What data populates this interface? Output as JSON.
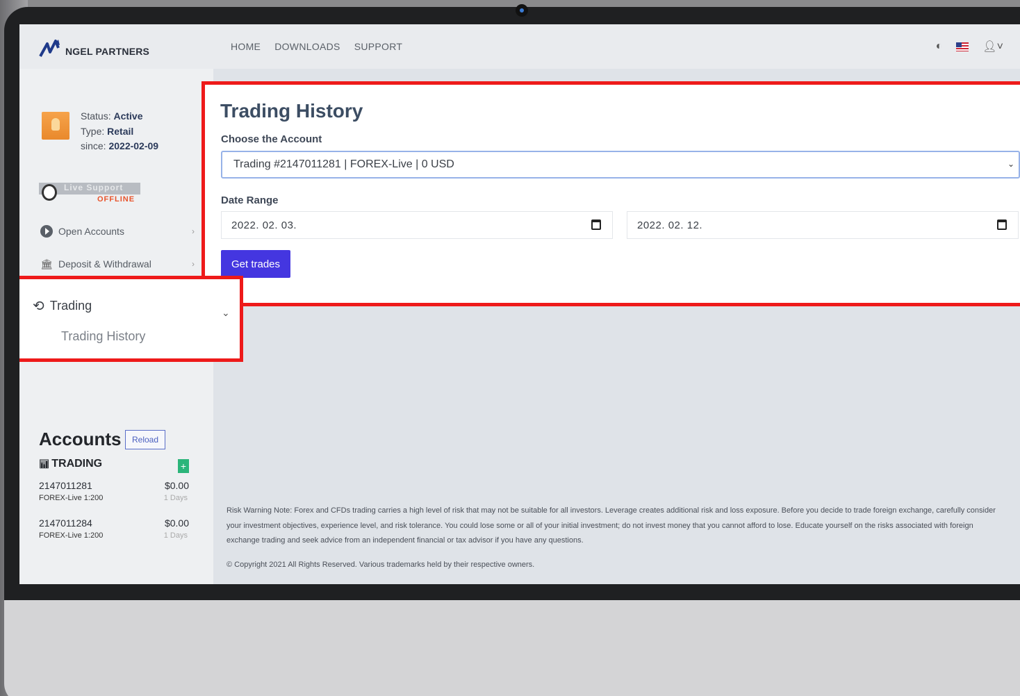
{
  "brand": {
    "name": "NGEL PARTNERS"
  },
  "nav": {
    "home": "HOME",
    "downloads": "DOWNLOADS",
    "support": "SUPPORT"
  },
  "profile": {
    "status_label": "Status:",
    "status_value": "Active",
    "type_label": "Type:",
    "type_value": "Retail",
    "since_label": "since:",
    "since_value": "2022-02-09"
  },
  "live_support": {
    "title": "Live Support",
    "state": "OFFLINE"
  },
  "sidebar": {
    "open_accounts": "Open Accounts",
    "deposit_withdrawal": "Deposit & Withdrawal",
    "trading": "Trading",
    "trading_history": "Trading History"
  },
  "accounts": {
    "title": "Accounts",
    "reload": "Reload",
    "group": "TRADING",
    "items": [
      {
        "number": "2147011281",
        "balance": "$0.00",
        "platform": "FOREX-Live 1:200",
        "days": "1 Days"
      },
      {
        "number": "2147011284",
        "balance": "$0.00",
        "platform": "FOREX-Live 1:200",
        "days": "1 Days"
      }
    ]
  },
  "main": {
    "title": "Trading History",
    "choose_account_label": "Choose the Account",
    "selected_account": "Trading #2147011281 | FOREX-Live | 0 USD",
    "date_range_label": "Date Range",
    "date_from": "2022. 02. 03.",
    "date_to": "2022. 02. 12.",
    "get_trades": "Get trades"
  },
  "footer": {
    "risk": "Risk Warning Note: Forex and CFDs trading carries a high level of risk that may not be suitable for all investors. Leverage creates additional risk and loss exposure. Before you decide to trade foreign exchange, carefully consider your investment objectives, experience level, and risk tolerance. You could lose some or all of your initial investment; do not invest money that you cannot afford to lose. Educate yourself on the risks associated with foreign exchange trading and seek advice from an independent financial or tax advisor if you have any questions.",
    "copyright": "© Copyright 2021 All Rights Reserved. Various trademarks held by their respective owners."
  },
  "colors": {
    "highlight": "#ee1a1a",
    "primary_button": "#4436e0",
    "active_green": "#2bb57a"
  }
}
